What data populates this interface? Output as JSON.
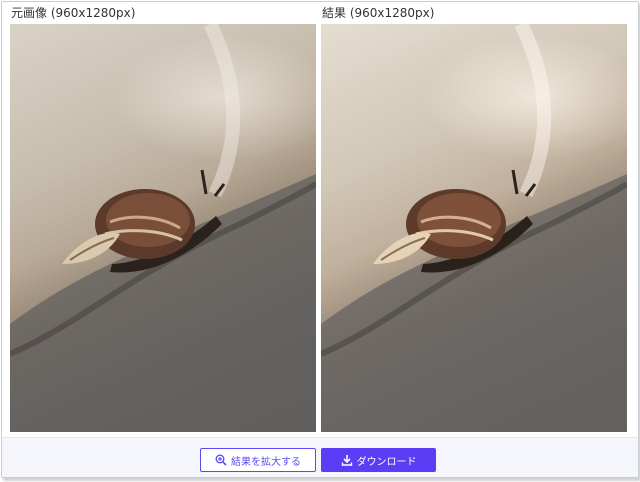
{
  "panels": {
    "original": {
      "title": "元画像 (960x1280px)"
    },
    "result": {
      "title": "結果 (960x1280px)"
    }
  },
  "buttons": {
    "zoom_label": "結果を拡大する",
    "download_label": "ダウンロード"
  },
  "icons": {
    "zoom": "zoom-in-icon",
    "download": "download-icon"
  },
  "colors": {
    "accent": "#5b3df5",
    "footer_bg": "#f4f6fb",
    "title_text": "#333333"
  }
}
